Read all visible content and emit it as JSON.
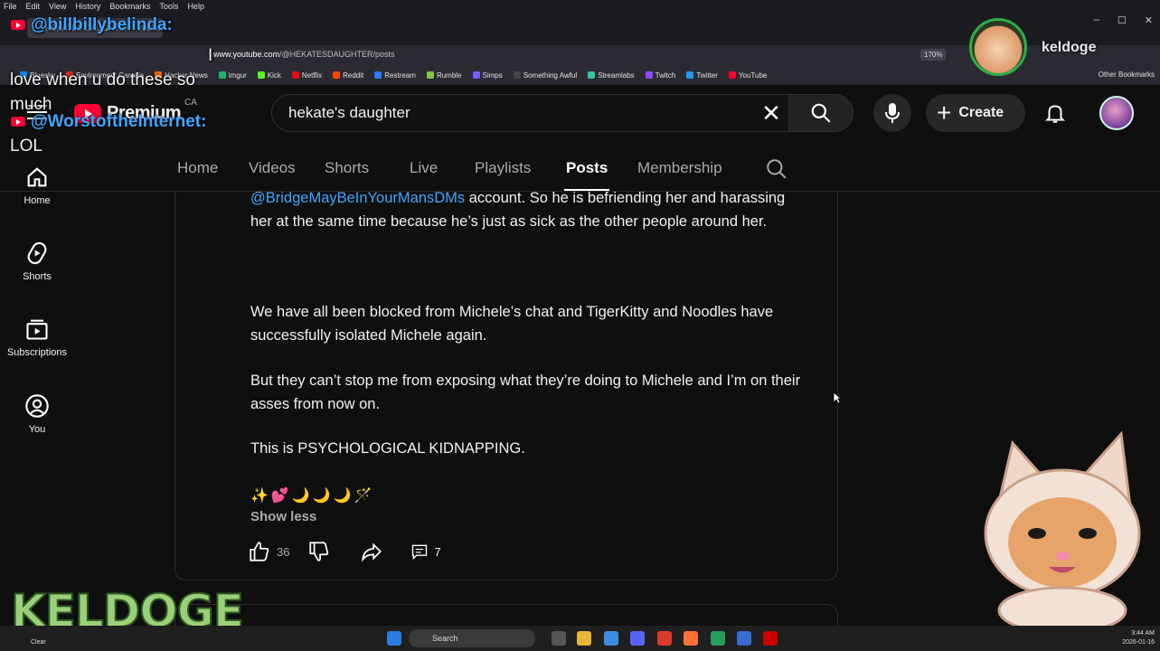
{
  "browser": {
    "menu": [
      "File",
      "Edit",
      "View",
      "History",
      "Bookmarks",
      "Tools",
      "Help"
    ],
    "tab_title": "HEKATES DAUGHTER - YouTube",
    "url_host": "www.youtube.com",
    "url_path": "/@HEKATESDAUGHTER/posts",
    "zoom": "170%",
    "bookmarks": [
      {
        "label": "Bluesky",
        "color": "#1185fe"
      },
      {
        "label": "Environment Canada",
        "color": "#d52b1e"
      },
      {
        "label": "Hacker News",
        "color": "#ff6600"
      },
      {
        "label": "imgur",
        "color": "#1bb76e"
      },
      {
        "label": "Kick",
        "color": "#53fc18"
      },
      {
        "label": "Netflix",
        "color": "#e50914"
      },
      {
        "label": "Reddit",
        "color": "#ff4500"
      },
      {
        "label": "Restream",
        "color": "#2b7cff"
      },
      {
        "label": "Rumble",
        "color": "#85c742"
      },
      {
        "label": "Simps",
        "color": "#7c5cff"
      },
      {
        "label": "Something Awful",
        "color": "#444444"
      },
      {
        "label": "Streamlabs",
        "color": "#31c3a2"
      },
      {
        "label": "Twitch",
        "color": "#9146ff"
      },
      {
        "label": "Twitter",
        "color": "#1d9bf0"
      },
      {
        "label": "YouTube",
        "color": "#ff0033"
      }
    ],
    "other_bookmarks": "Other Bookmarks"
  },
  "youtube": {
    "logo_text": "Premium",
    "country_code": "CA",
    "search_value": "hekate's daughter",
    "create_label": "Create",
    "sidebar": [
      {
        "label": "Home",
        "icon": "home-icon"
      },
      {
        "label": "Shorts",
        "icon": "shorts-icon"
      },
      {
        "label": "Subscriptions",
        "icon": "subscriptions-icon"
      },
      {
        "label": "You",
        "icon": "you-icon"
      }
    ],
    "channel_tabs": [
      "Home",
      "Videos",
      "Shorts",
      "Live",
      "Playlists",
      "Posts",
      "Membership"
    ],
    "active_tab": "Posts"
  },
  "post": {
    "mention": "@BridgeMayBeInYourMansDMs",
    "p1_rest": " account. So he is befriending her and harassing her at the same time because he’s just as sick as the other people around her.",
    "p2": "We have all been blocked from Michele’s chat and TigerKitty and Noodles have successfully isolated Michele again.",
    "p3": "But they can’t stop me from exposing what they’re doing to Michele and I’m on their asses from now on.",
    "p4": "This is PSYCHOLOGICAL KIDNAPPING.",
    "emojis": "✨💕🌙🌙🌙🪄",
    "show_less": "Show less",
    "likes": "36",
    "comments": "7"
  },
  "overlay": {
    "chat1_user": "@billbillybelinda:",
    "chat1_text": "I love when u do these so much",
    "chat2_user": "@WorstoftheInternet:",
    "chat2_text": "LOL",
    "streamer_name": "keldoge",
    "logo_text": "KELDOGE"
  },
  "taskbar": {
    "search_label": "Search",
    "weather": "Clear",
    "time": "3:44 AM",
    "date": "2026-01-16"
  }
}
